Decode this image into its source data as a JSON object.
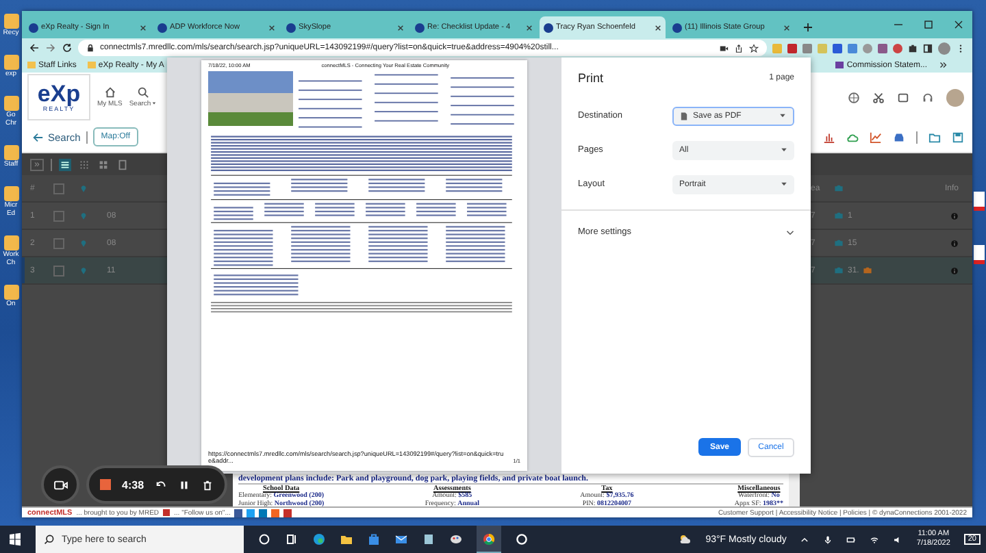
{
  "desktop": {
    "left_icons": [
      {
        "label": "Recy"
      },
      {
        "label": "exp"
      },
      {
        "label": "Go Chr"
      },
      {
        "label": "Staff"
      },
      {
        "label": "Micr Ed"
      },
      {
        "label": "Work Ch"
      },
      {
        "label": "On"
      }
    ]
  },
  "browser": {
    "tabs": [
      {
        "label": "eXp Realty - Sign In",
        "selected": false
      },
      {
        "label": "ADP Workforce Now",
        "selected": false
      },
      {
        "label": "SkySlope",
        "selected": false
      },
      {
        "label": "Re: Checklist Update - 4",
        "selected": false
      },
      {
        "label": "Tracy Ryan Schoenfeld",
        "selected": true
      },
      {
        "label": "(11) Illinois State Group",
        "selected": false
      }
    ],
    "url": "connectmls7.mredllc.com/mls/search/search.jsp?uniqueURL=143092199#/query?list=on&quick=true&address=4904%20still...",
    "bookmarks": [
      {
        "label": "Staff Links"
      },
      {
        "label": "eXp Realty - My A"
      }
    ],
    "bookmarks_right": [
      {
        "label": "Commission Statem..."
      }
    ]
  },
  "mls": {
    "logo": {
      "mark": "eXp",
      "sub": "REALTY"
    },
    "nav": [
      {
        "label": "My MLS"
      },
      {
        "label": "Search"
      }
    ],
    "back_label": "Search",
    "map_toggle": "Map:Off",
    "grid": {
      "expand": "»",
      "header": {
        "number": "#",
        "checked": false,
        "column_ea": "ea",
        "info": "Info"
      },
      "rows": [
        {
          "number": "1",
          "checked": false,
          "column_3": "08",
          "column_ea": "7",
          "photos": "1",
          "selected": false
        },
        {
          "number": "2",
          "checked": false,
          "column_3": "08",
          "column_ea": "7",
          "photos": "15",
          "selected": false
        },
        {
          "number": "3",
          "checked": false,
          "column_3": "11",
          "column_ea": "7",
          "photos": "31.",
          "selected": true
        }
      ]
    },
    "remarks_end": "development plans include: Park and playground, dog park, playing fields, and private boat launch.",
    "sections": [
      {
        "title": "School Data",
        "lines": [
          {
            "label": "Elementary:",
            "value": "Greenwood (200)"
          },
          {
            "label": "Junior High:",
            "value": "Northwood (200)"
          }
        ]
      },
      {
        "title": "Assessments",
        "lines": [
          {
            "label": "Amount:",
            "value": "$585"
          },
          {
            "label": "Frequency:",
            "value": "Annual"
          }
        ]
      },
      {
        "title": "Tax",
        "lines": [
          {
            "label": "Amount:",
            "value": "$7,935.76"
          },
          {
            "label": "PIN:",
            "value": "0812204007"
          }
        ]
      },
      {
        "title": "Miscellaneous",
        "lines": [
          {
            "label": "Waterfront:",
            "value": "No"
          },
          {
            "label": "Appx SF:",
            "value": "1983**"
          }
        ]
      }
    ],
    "footer": {
      "brand": "connectMLS",
      "credit": "... brought to you by MRED",
      "follow": "... \"Follow us on\"...",
      "links": "Customer Support | Accessibility Notice | Policies | © dynaConnections 2001-2022"
    }
  },
  "print_dialog": {
    "preview": {
      "date": "7/18/22, 10:00 AM",
      "title": "connectMLS - Connecting Your Real Estate Community",
      "url": "https://connectmls7.mredllc.com/mls/search/search.jsp?uniqueURL=143092199#/query?list=on&quick=true&addr...",
      "page": "1/1"
    },
    "title": "Print",
    "page_count": "1 page",
    "settings": [
      {
        "label": "Destination",
        "value": "Save as PDF",
        "kind": "destination"
      },
      {
        "label": "Pages",
        "value": "All",
        "kind": "select"
      },
      {
        "label": "Layout",
        "value": "Portrait",
        "kind": "select"
      }
    ],
    "more_settings": "More settings",
    "save": "Save",
    "cancel": "Cancel"
  },
  "recorder": {
    "time": "4:38"
  },
  "taskbar": {
    "search_placeholder": "Type here to search",
    "weather": "93°F Mostly cloudy",
    "time": "11:00 AM",
    "date": "7/18/2022",
    "notifications": "20"
  }
}
